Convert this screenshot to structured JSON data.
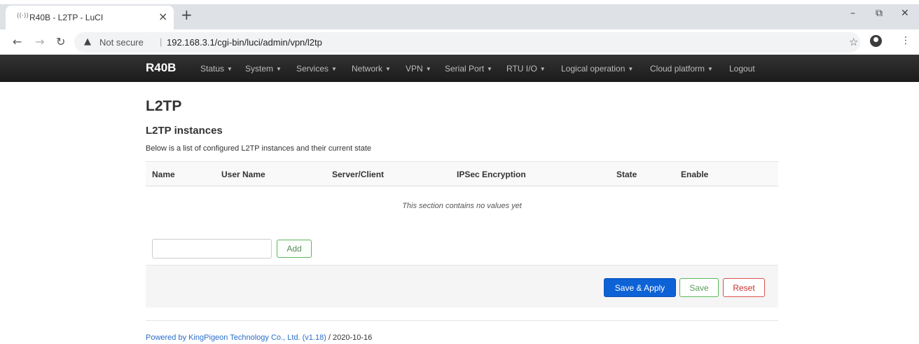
{
  "browser": {
    "tab_title": "R40B - L2TP - LuCI",
    "favicon": "((·))",
    "close_glyph": "×",
    "newtab_glyph": "+",
    "window_controls": {
      "minimize": "–",
      "restore": "⧉",
      "close": "✕"
    },
    "security": "Not secure",
    "url": "192.168.3.1/cgi-bin/luci/admin/vpn/l2tp"
  },
  "header": {
    "brand": "R40B",
    "menu": [
      {
        "label": "Status",
        "caret": "▼"
      },
      {
        "label": "System",
        "caret": "▼"
      },
      {
        "label": "Services",
        "caret": "▼"
      },
      {
        "label": "Network",
        "caret": "▼"
      },
      {
        "label": "VPN",
        "caret": "▼"
      },
      {
        "label": "Serial Port",
        "caret": "▼"
      },
      {
        "label": "RTU I/O",
        "caret": "▼"
      },
      {
        "label": "Logical operation",
        "caret": "▼"
      },
      {
        "label": "Cloud platform",
        "caret": "▼"
      },
      {
        "label": "Logout"
      }
    ]
  },
  "page": {
    "title": "L2TP",
    "section_title": "L2TP instances",
    "section_desc": "Below is a list of configured L2TP instances and their current state"
  },
  "table": {
    "columns": [
      "Name",
      "User Name",
      "Server/Client",
      "IPSec Encryption",
      "State",
      "Enable"
    ],
    "empty_text": "This section contains no values yet"
  },
  "form": {
    "add_input_value": "",
    "add_label": "Add"
  },
  "actions": {
    "save_apply": "Save & Apply",
    "save": "Save",
    "reset": "Reset"
  },
  "footer": {
    "link_text": "Powered by KingPigeon Technology Co., Ltd. (v1.18)",
    "suffix": " / 2020-10-16"
  },
  "colors": {
    "header_bg": "#222222",
    "primary_button": "#0d62d6",
    "save_border": "#5cb85c",
    "reset_border": "#d9534f",
    "link": "#2a6fc9"
  }
}
